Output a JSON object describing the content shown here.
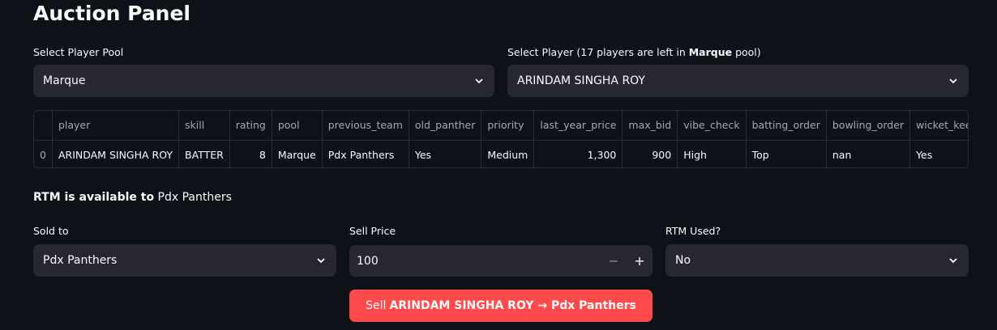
{
  "page": {
    "title": "Auction Panel"
  },
  "player_pool": {
    "label": "Select Player Pool",
    "value": "Marque"
  },
  "player_select": {
    "label_prefix": "Select Player (17 players are left in ",
    "label_pool": "Marque",
    "label_suffix": " pool)",
    "value": "ARINDAM SINGHA ROY"
  },
  "table": {
    "columns": [
      "",
      "player",
      "skill",
      "rating",
      "pool",
      "previous_team",
      "old_panther",
      "priority",
      "last_year_price",
      "max_bid",
      "vibe_check",
      "batting_order",
      "bowling_order",
      "wicket_keeper"
    ],
    "row": [
      "0",
      "ARINDAM SINGHA ROY",
      "BATTER",
      "8",
      "Marque",
      "Pdx Panthers",
      "Yes",
      "Medium",
      "1,300",
      "900",
      "High",
      "Top",
      "nan",
      "Yes"
    ]
  },
  "rtm": {
    "prefix": "RTM is available to",
    "team": "Pdx Panthers"
  },
  "sold_to": {
    "label": "Sold to",
    "value": "Pdx Panthers"
  },
  "sell_price": {
    "label": "Sell Price",
    "value": "100",
    "minus": "−",
    "plus": "+"
  },
  "rtm_used": {
    "label": "RTM Used?",
    "value": "No"
  },
  "sell_button": {
    "prefix": "Sell",
    "detail": "ARINDAM SINGHA ROY → Pdx Panthers"
  },
  "colors": {
    "background": "#0e1117",
    "widget": "#262730",
    "accent": "#ff4b4b"
  }
}
